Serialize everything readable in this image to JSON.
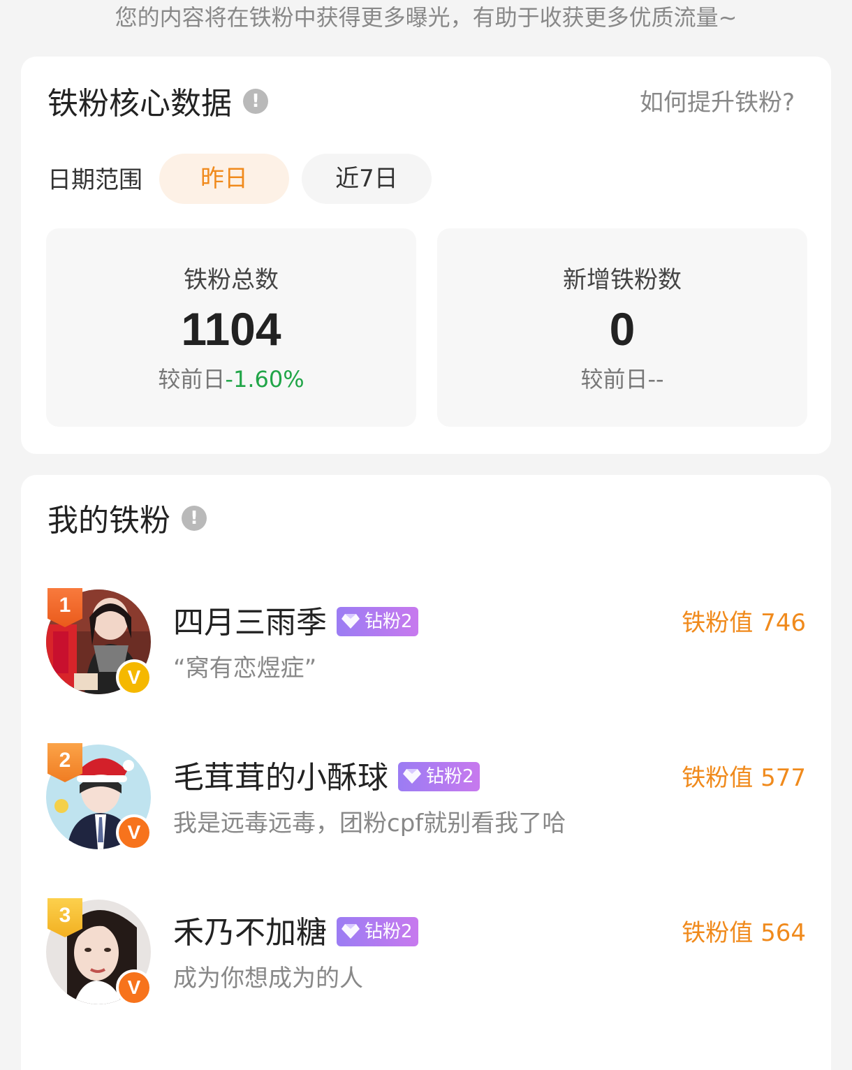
{
  "top_hint": "您的内容将在铁粉中获得更多曝光，有助于收获更多优质流量~",
  "core": {
    "title": "铁粉核心数据",
    "info_symbol": "!",
    "how_link": "如何提升铁粉?",
    "date_label": "日期范围",
    "tabs": [
      {
        "label": "昨日",
        "active": true
      },
      {
        "label": "近7日",
        "active": false
      }
    ],
    "stats": [
      {
        "label": "铁粉总数",
        "value": "1104",
        "change_prefix": "较前日",
        "change_value": "-1.60%"
      },
      {
        "label": "新增铁粉数",
        "value": "0",
        "change_prefix": "较前日",
        "change_value": "--"
      }
    ]
  },
  "fans_section": {
    "title": "我的铁粉",
    "info_symbol": "!",
    "fans": [
      {
        "rank": "1",
        "name": "四月三雨季",
        "level": "钻粉2",
        "bio": "“窝有恋煜症”",
        "score": "铁粉值 746",
        "verify": "V"
      },
      {
        "rank": "2",
        "name": "毛茸茸的小酥球",
        "level": "钻粉2",
        "bio": "我是远毒远毒，团粉cpf就别看我了哈",
        "score": "铁粉值 577",
        "verify": "V"
      },
      {
        "rank": "3",
        "name": "禾乃不加糖",
        "level": "钻粉2",
        "bio": "成为你想成为的人",
        "score": "铁粉值 564",
        "verify": "V"
      }
    ]
  },
  "colors": {
    "accent_orange": "#f08a1c",
    "negative_green": "#21a548",
    "diamond_purple": "#9b7cf3"
  }
}
